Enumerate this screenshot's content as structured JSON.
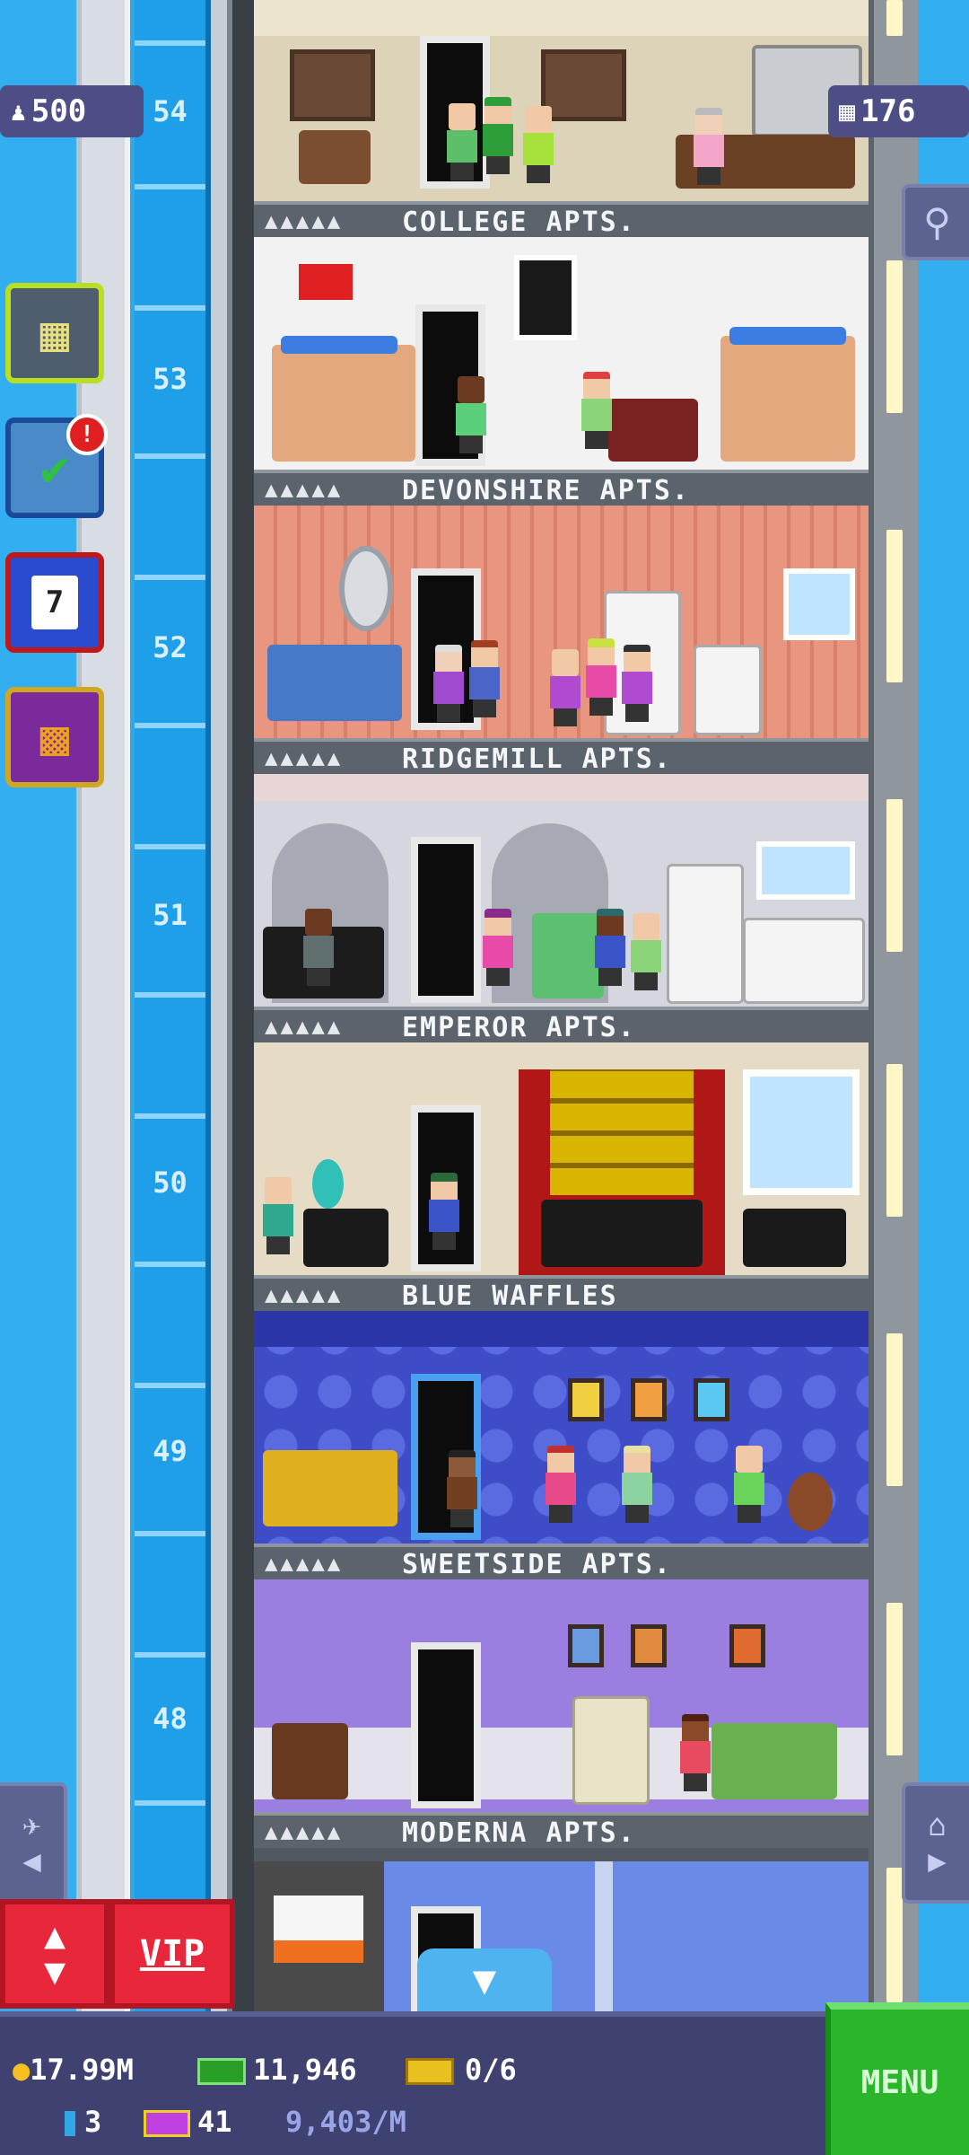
{
  "hud": {
    "population": "500",
    "population_icon": "person-icon",
    "floor_count": "176",
    "floor_count_icon": "building-icon",
    "search_icon": "magnifier-icon"
  },
  "shaft": {
    "floor_numbers": [
      "54",
      "53",
      "52",
      "51",
      "50",
      "49",
      "48"
    ]
  },
  "side_buttons": [
    {
      "name": "build-floor-button",
      "icon": "building-icon"
    },
    {
      "name": "missions-button",
      "icon": "checklist-icon",
      "badge": "!"
    },
    {
      "name": "calendar-button",
      "icon": "calendar-icon",
      "day": "7"
    },
    {
      "name": "gift-button",
      "icon": "gift-icon"
    }
  ],
  "floors": [
    {
      "number": "54",
      "name": "COLLEGE APTS.",
      "stars": "▲▲▲▲▲"
    },
    {
      "number": "53",
      "name": "DEVONSHIRE APTS.",
      "stars": "▲▲▲▲▲"
    },
    {
      "number": "52",
      "name": "RIDGEMILL APTS.",
      "stars": "▲▲▲▲▲"
    },
    {
      "number": "51",
      "name": "EMPEROR APTS.",
      "stars": "▲▲▲▲▲"
    },
    {
      "number": "50",
      "name": "BLUE WAFFLES",
      "stars": "▲▲▲▲▲"
    },
    {
      "number": "49",
      "name": "SWEETSIDE APTS.",
      "stars": "▲▲▲▲▲"
    },
    {
      "number": "48",
      "name": "MODERNA APTS.",
      "stars": "▲▲▲▲▲"
    }
  ],
  "controls": {
    "vip_label": "VIP",
    "elevator_up": "▲",
    "elevator_down": "▼",
    "scroll_down": "▼"
  },
  "stats": {
    "coins": "17.99M",
    "bux": "11,946",
    "tickets": "0/6",
    "keys": "3",
    "vip_tickets": "41",
    "income_rate": "9,403/M"
  },
  "menu_label": "MENU",
  "colors": {
    "sky": "#33aef0",
    "hud": "#4c4e85",
    "menu": "#2bb52b",
    "vip": "#e8283a"
  }
}
